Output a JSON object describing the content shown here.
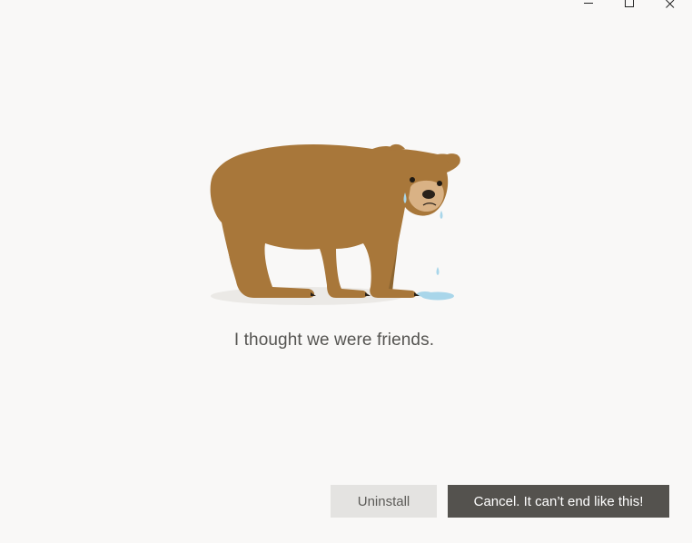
{
  "window": {
    "controls": {
      "minimize_icon": "minimize-icon",
      "maximize_icon": "maximize-icon",
      "close_icon": "close-icon"
    }
  },
  "illustration": {
    "name": "crying-bear",
    "colors": {
      "fur": "#a8773a",
      "fur_dark": "#8d6530",
      "muzzle": "#d9b285",
      "tears": "#a9d6ea",
      "shadow": "#ebe9e6"
    }
  },
  "message": "I thought we were friends.",
  "buttons": {
    "uninstall": "Uninstall",
    "cancel": "Cancel. It can’t end like this!"
  },
  "colors": {
    "background": "#f9f8f7",
    "uninstall_bg": "#e4e3e1",
    "cancel_bg": "#54524e",
    "text": "#555451"
  }
}
